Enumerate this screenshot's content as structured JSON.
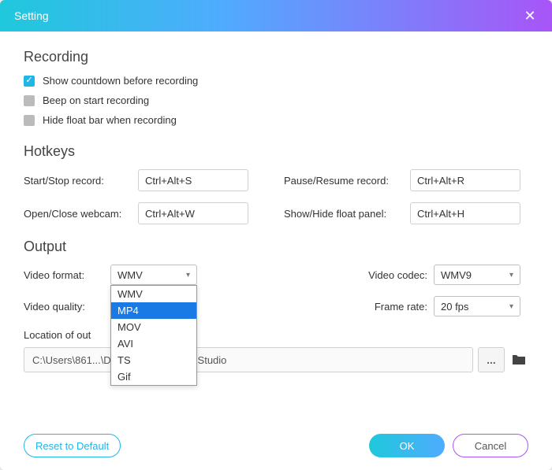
{
  "title": "Setting",
  "recording": {
    "heading": "Recording",
    "options": {
      "countdown": {
        "label": "Show countdown before recording",
        "checked": true
      },
      "beep": {
        "label": "Beep on start recording",
        "checked": false
      },
      "hide_float": {
        "label": "Hide float bar when recording",
        "checked": false
      }
    }
  },
  "hotkeys": {
    "heading": "Hotkeys",
    "start_stop": {
      "label": "Start/Stop record:",
      "value": "Ctrl+Alt+S"
    },
    "pause_resume": {
      "label": "Pause/Resume record:",
      "value": "Ctrl+Alt+R"
    },
    "webcam": {
      "label": "Open/Close webcam:",
      "value": "Ctrl+Alt+W"
    },
    "float_panel": {
      "label": "Show/Hide float panel:",
      "value": "Ctrl+Alt+H"
    }
  },
  "output": {
    "heading": "Output",
    "video_format": {
      "label": "Video format:",
      "value": "WMV",
      "open": true,
      "options": [
        "WMV",
        "MP4",
        "MOV",
        "AVI",
        "TS",
        "Gif"
      ],
      "highlighted": "MP4"
    },
    "video_codec": {
      "label": "Video codec:",
      "value": "WMV9"
    },
    "video_quality": {
      "label": "Video quality:"
    },
    "frame_rate": {
      "label": "Frame rate:",
      "value": "20 fps"
    },
    "location": {
      "label": "Location of out",
      "path": "C:\\Users\\861...\\Documents\\...desoft Studio",
      "browse_label": "..."
    }
  },
  "footer": {
    "reset": "Reset to Default",
    "ok": "OK",
    "cancel": "Cancel"
  }
}
